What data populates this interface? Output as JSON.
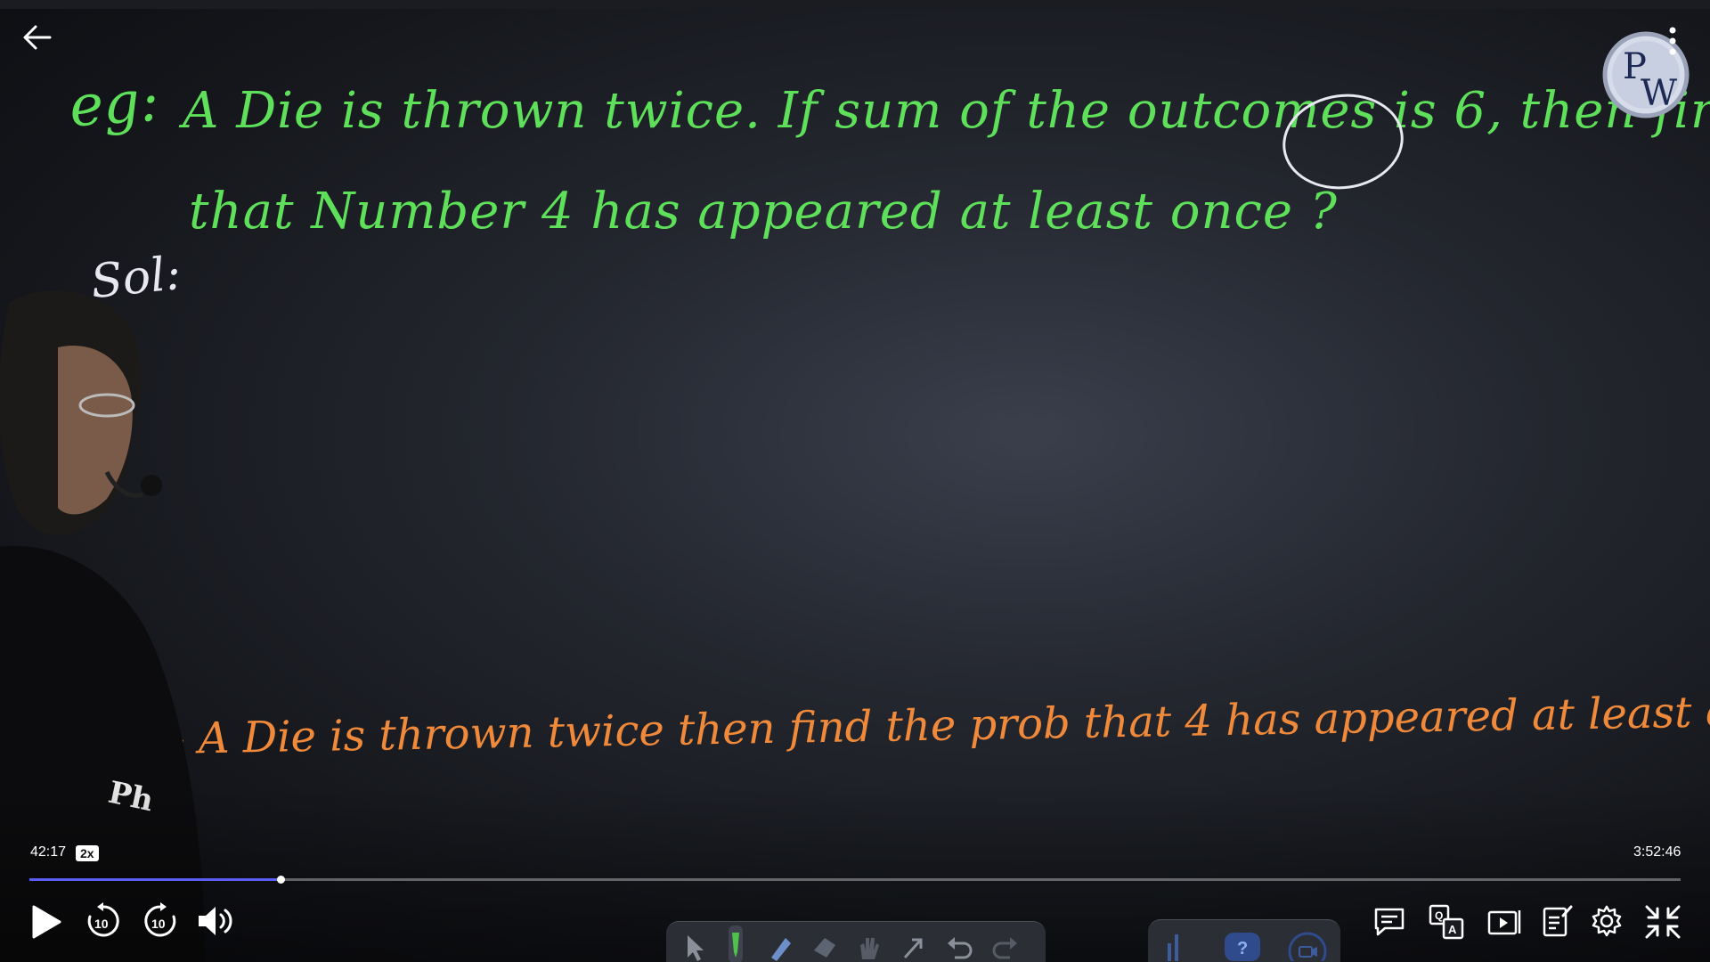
{
  "board": {
    "question_label": "eg:",
    "question_line1": "A Die is thrown twice. If sum of the outcomes is 6, then find the prob",
    "question_line2": "that Number 4 has appeared at least once ?",
    "solution_label": "Sol:",
    "restated": ":- A Die is thrown twice then find the prob that 4 has appeared at least once = ?"
  },
  "player": {
    "current_time": "42:17",
    "speed": "2x",
    "total_time": "3:52:46",
    "progress_fraction": 0.152,
    "accent_color": "#5a5cf2"
  },
  "icons": {
    "back": "arrow-left-icon",
    "more": "more-vertical-icon",
    "play": "play-icon",
    "rewind": "rewind-10-icon",
    "forward": "forward-10-icon",
    "volume": "volume-icon",
    "chat": "chat-icon",
    "translate": "translate-icon",
    "playlist": "playlist-icon",
    "notes": "notes-icon",
    "settings": "gear-icon",
    "exit_fullscreen": "exit-fullscreen-icon"
  },
  "logo": {
    "text_top": "P",
    "text_bottom": "W"
  },
  "shirt_text": "Ph"
}
